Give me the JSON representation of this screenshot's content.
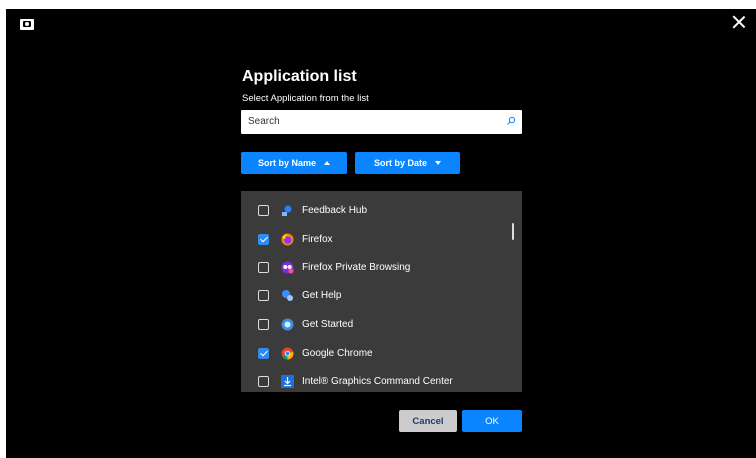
{
  "dialog": {
    "title": "Application list",
    "subtitle": "Select Application from the list"
  },
  "search": {
    "placeholder": "Search",
    "icon": "search-icon"
  },
  "sort": {
    "by_name_label": "Sort by Name",
    "by_date_label": "Sort by Date"
  },
  "apps": [
    {
      "label": "Feedback Hub",
      "checked": false,
      "icon": "feedback-hub-icon"
    },
    {
      "label": "Firefox",
      "checked": true,
      "icon": "firefox-icon"
    },
    {
      "label": "Firefox Private Browsing",
      "checked": false,
      "icon": "firefox-private-icon"
    },
    {
      "label": "Get Help",
      "checked": false,
      "icon": "get-help-icon"
    },
    {
      "label": "Get Started",
      "checked": false,
      "icon": "get-started-icon"
    },
    {
      "label": "Google Chrome",
      "checked": true,
      "icon": "chrome-icon"
    },
    {
      "label": "Intel® Graphics Command Center",
      "checked": false,
      "icon": "intel-graphics-icon"
    }
  ],
  "buttons": {
    "cancel": "Cancel",
    "ok": "OK"
  },
  "colors": {
    "accent": "#0a84ff",
    "list_background": "#3b3b3b",
    "window_background": "#000000"
  }
}
